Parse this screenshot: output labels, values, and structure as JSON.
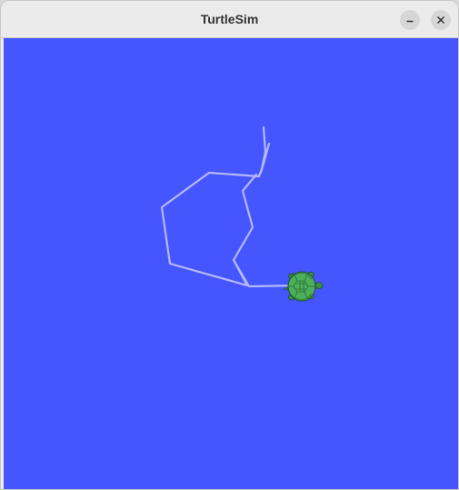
{
  "window": {
    "title": "TurtleSim"
  },
  "titlebar_buttons": {
    "minimize_icon": "minimize-icon",
    "close_icon": "close-icon"
  },
  "canvas": {
    "background_color": "#4556ff",
    "pen_color": "#b3b8ff",
    "turtle_color": "#4caf5a"
  }
}
